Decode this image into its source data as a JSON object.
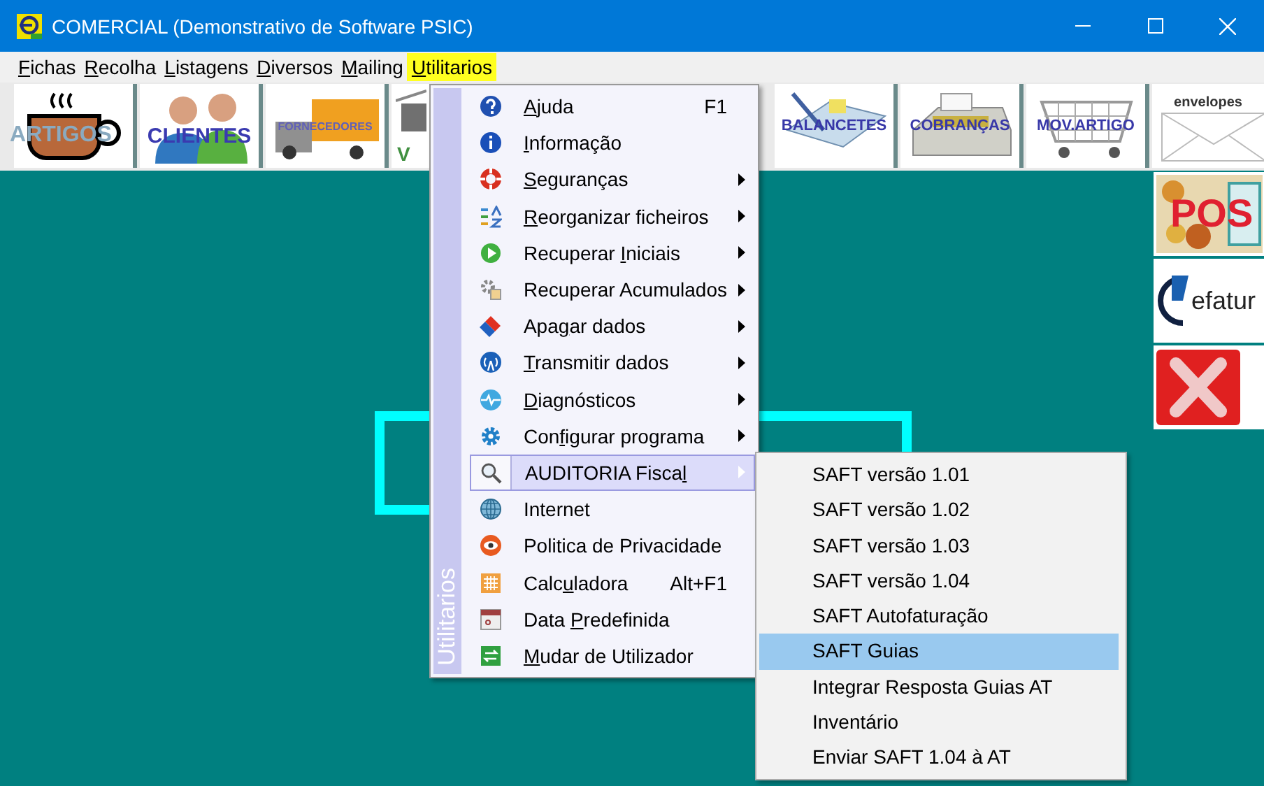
{
  "window": {
    "title": "COMERCIAL (Demonstrativo de Software PSIC)"
  },
  "menu_bar": [
    {
      "label": {
        "key": "F",
        "post": "ichas"
      },
      "selected": false
    },
    {
      "label": {
        "key": "R",
        "post": "ecolha"
      },
      "selected": false
    },
    {
      "label": {
        "key": "L",
        "post": "istagens"
      },
      "selected": false
    },
    {
      "label": {
        "key": "D",
        "post": "iversos"
      },
      "selected": false
    },
    {
      "label": {
        "key": "M",
        "post": "ailing"
      },
      "selected": false
    },
    {
      "label": {
        "key": "U",
        "post": "tilitarios"
      },
      "selected": true
    }
  ],
  "toolbar": [
    {
      "label": "ARTIGOS"
    },
    {
      "label": "CLIENTES"
    },
    {
      "label": "FORNECEDORES"
    },
    {
      "label": "V"
    },
    {
      "label": "BALANCETES"
    },
    {
      "label": "COBRANÇAS"
    },
    {
      "label": "MOV.ARTIGO"
    },
    {
      "label": "envelopes"
    }
  ],
  "side_tiles": [
    {
      "label": "POS"
    },
    {
      "label": "efatur"
    }
  ],
  "menu": {
    "title": "Utilitarios",
    "items": [
      {
        "label": {
          "key": "A",
          "post": "juda"
        },
        "shortcut": "F1",
        "has_submenu": false,
        "selected": false
      },
      {
        "label": {
          "key": "I",
          "post": "nformação"
        },
        "has_submenu": false,
        "selected": false
      },
      {
        "label": {
          "key": "S",
          "post": "eguranças"
        },
        "has_submenu": true,
        "selected": false
      },
      {
        "label": {
          "key": "R",
          "post": "eorganizar ficheiros"
        },
        "has_submenu": true,
        "selected": false
      },
      {
        "label": {
          "pre": "Recuperar ",
          "key": "I",
          "post": "niciais"
        },
        "has_submenu": true,
        "selected": false
      },
      {
        "label": {
          "pre": "Recuperar Acumulados"
        },
        "has_submenu": true,
        "selected": false
      },
      {
        "label": {
          "pre": "Apa",
          "key": "g",
          "post": "ar dados"
        },
        "has_submenu": true,
        "selected": false
      },
      {
        "label": {
          "key": "T",
          "post": "ransmitir dados"
        },
        "has_submenu": true,
        "selected": false
      },
      {
        "label": {
          "key": "D",
          "post": "iagnósticos"
        },
        "has_submenu": true,
        "selected": false
      },
      {
        "label": {
          "pre": "Con",
          "key": "f",
          "post": "igurar programa"
        },
        "has_submenu": true,
        "selected": false
      },
      {
        "label": {
          "pre": "AUDITORIA Fisca",
          "key": "l"
        },
        "has_submenu": true,
        "selected": true
      },
      {
        "label": {
          "pre": "Internet"
        },
        "has_submenu": false,
        "selected": false
      },
      {
        "label": {
          "pre": "Politica de Privacidade"
        },
        "has_submenu": false,
        "selected": false
      },
      {
        "label": {
          "pre": "Calc",
          "key": "u",
          "post": "ladora"
        },
        "shortcut": "Alt+F1",
        "has_submenu": false,
        "selected": false
      },
      {
        "label": {
          "pre": "Data ",
          "key": "P",
          "post": "redefinida"
        },
        "has_submenu": false,
        "selected": false
      },
      {
        "label": {
          "key": "M",
          "post": "udar de Utilizador"
        },
        "has_submenu": false,
        "selected": false
      }
    ]
  },
  "submenu": {
    "items": [
      {
        "label": "SAFT versão 1.01",
        "selected": false
      },
      {
        "label": "SAFT versão 1.02",
        "selected": false
      },
      {
        "label": "SAFT versão 1.03",
        "selected": false
      },
      {
        "label": "SAFT versão 1.04",
        "selected": false
      },
      {
        "label": "SAFT Autofaturação",
        "selected": false
      },
      {
        "label": "SAFT Guias",
        "selected": true
      },
      {
        "label": "Integrar Resposta Guias AT",
        "selected": false
      },
      {
        "label": "Inventário",
        "selected": false
      },
      {
        "label": "Enviar SAFT 1.04 à AT",
        "selected": false
      }
    ]
  }
}
